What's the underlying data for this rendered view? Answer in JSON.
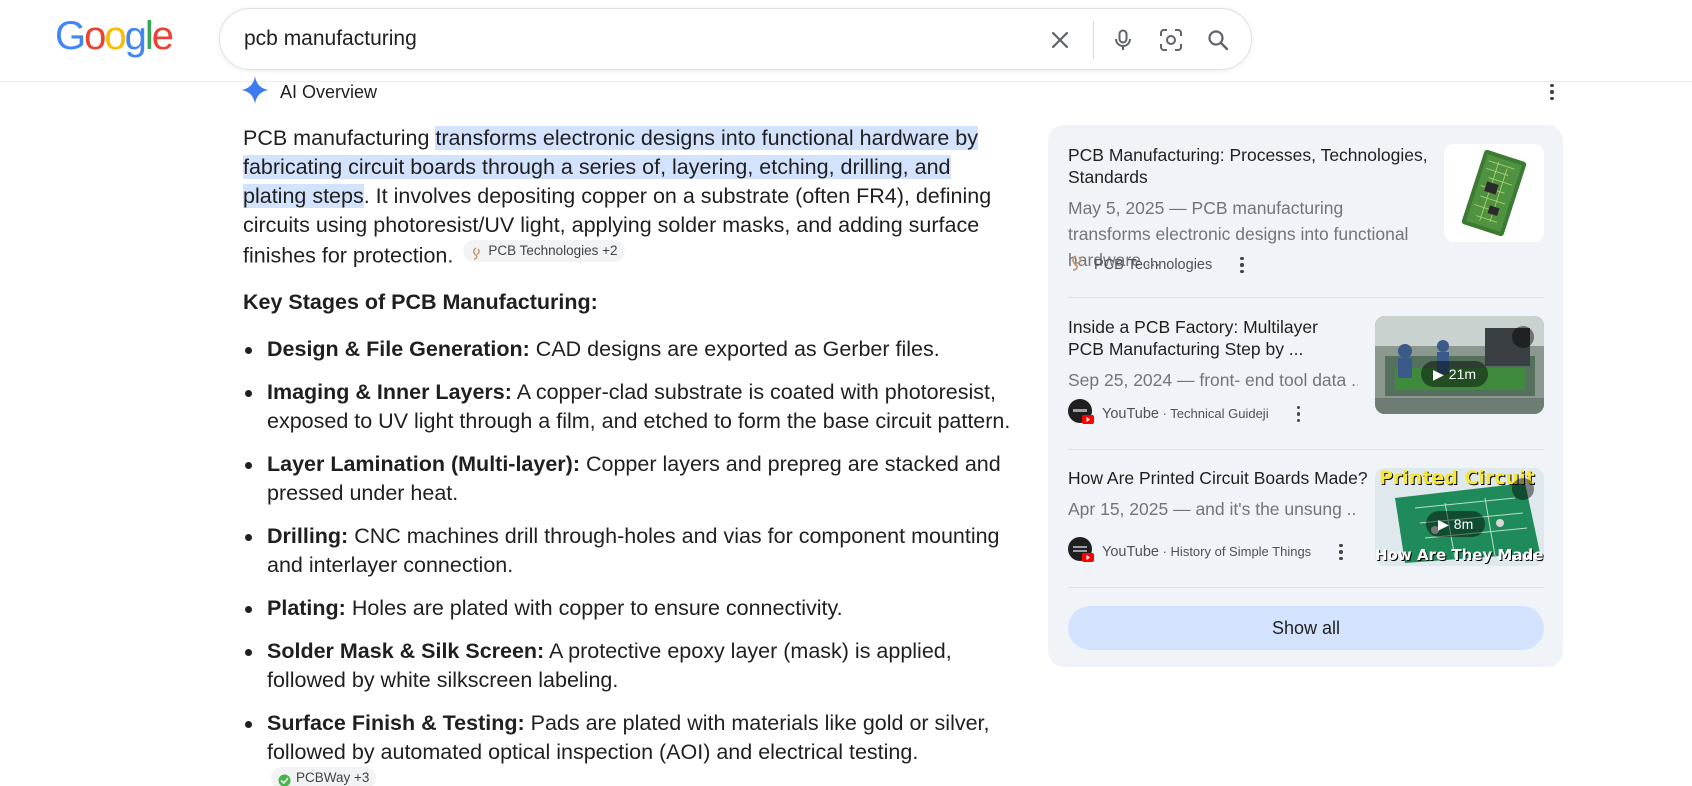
{
  "header": {
    "logo_text": "Google",
    "search": {
      "value": "pcb manufacturing",
      "placeholder": ""
    }
  },
  "ai_overview": {
    "label": "AI Overview",
    "intro": {
      "lead": "PCB manufacturing ",
      "highlight": "transforms electronic designs into functional hardware by fabricating circuit boards through a series of, layering, etching, drilling, and plating steps",
      "rest": ". It involves depositing copper on a substrate (often FR4), defining circuits using photoresist/UV light, applying solder masks, and adding surface finishes for protection.",
      "chip": "PCB Technologies +2"
    },
    "stages_title": "Key Stages of PCB Manufacturing:",
    "stages": [
      {
        "title": "Design & File Generation:",
        "text": " CAD designs are exported as Gerber files."
      },
      {
        "title": "Imaging & Inner Layers:",
        "text": " A copper-clad substrate is coated with photoresist, exposed to UV light through a film, and etched to form the base circuit pattern."
      },
      {
        "title": "Layer Lamination (Multi-layer):",
        "text": " Copper layers and prepreg are stacked and pressed under heat."
      },
      {
        "title": "Drilling:",
        "text": " CNC machines drill through-holes and vias for component mounting and interlayer connection."
      },
      {
        "title": "Plating:",
        "text": " Holes are plated with copper to ensure connectivity."
      },
      {
        "title": "Solder Mask & Silk Screen:",
        "text": " A protective epoxy layer (mask) is applied, followed by white silkscreen labeling."
      },
      {
        "title": "Surface Finish & Testing:",
        "text": " Pads are plated with materials like gold or silver, followed by automated optical inspection (AOI) and electrical testing.",
        "chip": "PCBWay +3"
      }
    ]
  },
  "sources": {
    "cards": [
      {
        "title": "PCB Manufacturing: Processes, Technologies, Standards",
        "snippet": "May 5, 2025 — PCB manufacturing transforms electronic designs into functional hardware ...",
        "source": "PCB Technologies",
        "sub": ""
      },
      {
        "title": "Inside a PCB Factory: Multilayer PCB Manufacturing Step by ...",
        "snippet": "Sep 25, 2024 — front- end tool data ...",
        "source": "YouTube",
        "sub": " · Technical Guideji",
        "duration": "21m"
      },
      {
        "title": "How Are Printed Circuit Boards Made?",
        "snippet": "Apr 15, 2025 — and it's the unsung ...",
        "source": "YouTube",
        "sub": " · History of Simple Things",
        "duration": "8m",
        "thumb_top": "Printed Circuit Boards",
        "thumb_bottom": "How Are They Made!"
      }
    ],
    "show_all": "Show all"
  },
  "colors": {
    "accent": "#1a73e8",
    "highlight": "#d3e3fd",
    "panel": "#f0f4f9"
  }
}
